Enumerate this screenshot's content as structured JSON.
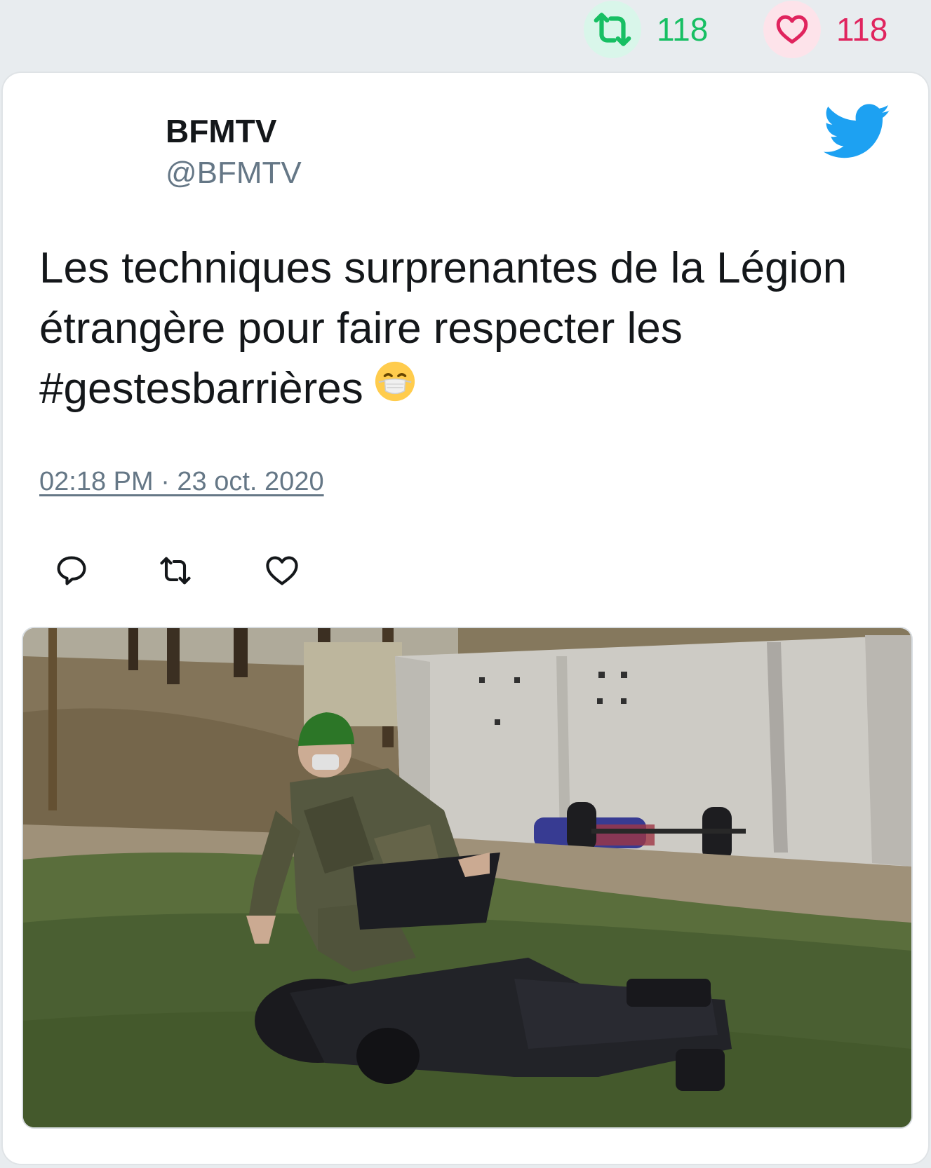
{
  "stats": {
    "retweets": "118",
    "likes": "118",
    "retweet_color": "#17bf63",
    "like_color": "#e0245e"
  },
  "tweet": {
    "author_name": "BFMTV",
    "author_handle": "@BFMTV",
    "text": "Les techniques surprenantes de la Légion étrangère pour faire respecter les #gestesbarrières",
    "emoji": "face-with-medical-mask",
    "timestamp": "02:18 PM · 23 oct. 2020"
  },
  "icons": {
    "brand": "twitter-bird-icon",
    "actions": [
      "reply-icon",
      "retweet-icon",
      "like-icon"
    ]
  },
  "media": {
    "type": "video-thumbnail",
    "accent": "#1da1f2"
  }
}
